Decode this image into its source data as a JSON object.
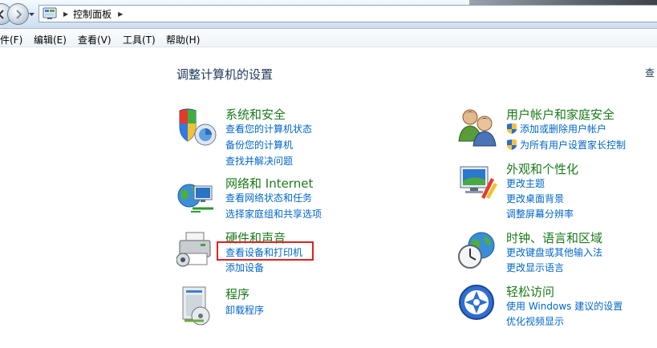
{
  "window": {
    "breadcrumb": "控制面板"
  },
  "menu": [
    {
      "label": "件(F)"
    },
    {
      "label": "编辑(E)"
    },
    {
      "label": "查看(V)"
    },
    {
      "label": "工具(T)"
    },
    {
      "label": "帮助(H)"
    }
  ],
  "content": {
    "title": "调整计算机的设置",
    "view_by": "查"
  },
  "categories": [
    {
      "title": "系统和安全",
      "icon": "system-security-icon",
      "links": [
        "查看您的计算机状态",
        "备份您的计算机",
        "查找并解决问题"
      ]
    },
    {
      "title": "网络和 Internet",
      "icon": "network-internet-icon",
      "links": [
        "查看网络状态和任务",
        "选择家庭组和共享选项"
      ]
    },
    {
      "title": "硬件和声音",
      "icon": "hardware-sound-icon",
      "links": [
        "查看设备和打印机",
        "添加设备"
      ]
    },
    {
      "title": "程序",
      "icon": "programs-icon",
      "links": [
        "卸载程序"
      ]
    },
    {
      "title": "用户帐户和家庭安全",
      "icon": "user-accounts-icon",
      "links": [
        "添加或删除用户帐户",
        "为所有用户设置家长控制"
      ]
    },
    {
      "title": "外观和个性化",
      "icon": "appearance-icon",
      "links": [
        "更改主题",
        "更改桌面背景",
        "调整屏幕分辨率"
      ]
    },
    {
      "title": "时钟、语言和区域",
      "icon": "clock-language-icon",
      "links": [
        "更改键盘或其他输入法",
        "更改显示语言"
      ]
    },
    {
      "title": "轻松访问",
      "icon": "ease-of-access-icon",
      "links": [
        "使用 Windows 建议的设置",
        "优化视频显示"
      ]
    }
  ],
  "colors": {
    "link": "#0066cc",
    "category_title": "#1a7a1a",
    "highlight": "#e02020"
  }
}
